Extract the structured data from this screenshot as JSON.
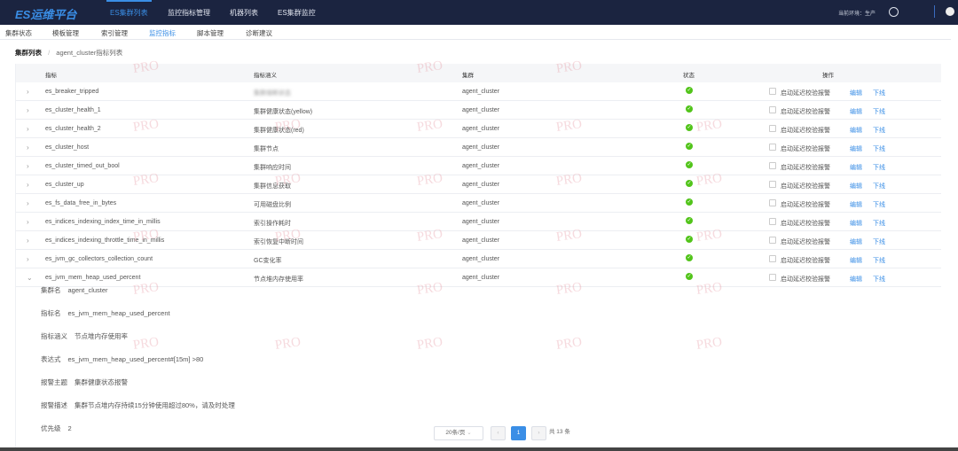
{
  "header": {
    "logo": "ES运维平台",
    "nav": [
      "ES集群列表",
      "监控指标管理",
      "机器列表",
      "ES集群监控"
    ],
    "active_nav": 0,
    "env_label": "当前环境：生产"
  },
  "subnav": {
    "tabs": [
      "集群状态",
      "模板管理",
      "索引管理",
      "监控指标",
      "脚本管理",
      "诊断建议"
    ],
    "active": 3
  },
  "breadcrumb": {
    "root": "集群列表",
    "sep": "/",
    "current": "agent_cluster指标列表"
  },
  "table": {
    "columns": [
      "指标",
      "指标涵义",
      "集群",
      "状态",
      "操作"
    ],
    "op_checkbox_label": "启动延迟校验报警",
    "edit": "编辑",
    "offline": "下线",
    "rows": [
      {
        "metric": "es_breaker_tripped",
        "meaning": "集群熔断状态",
        "cluster": "agent_cluster",
        "blurred": true
      },
      {
        "metric": "es_cluster_health_1",
        "meaning": "集群健康状态(yellow)",
        "cluster": "agent_cluster"
      },
      {
        "metric": "es_cluster_health_2",
        "meaning": "集群健康状态(red)",
        "cluster": "agent_cluster"
      },
      {
        "metric": "es_cluster_host",
        "meaning": "集群节点",
        "cluster": "agent_cluster"
      },
      {
        "metric": "es_cluster_timed_out_bool",
        "meaning": "集群响应时间",
        "cluster": "agent_cluster"
      },
      {
        "metric": "es_cluster_up",
        "meaning": "集群信息获取",
        "cluster": "agent_cluster"
      },
      {
        "metric": "es_fs_data_free_in_bytes",
        "meaning": "可用磁盘比例",
        "cluster": "agent_cluster"
      },
      {
        "metric": "es_indices_indexing_index_time_in_millis",
        "meaning": "索引操作耗时",
        "cluster": "agent_cluster"
      },
      {
        "metric": "es_indices_indexing_throttle_time_in_millis",
        "meaning": "索引恢复中断时间",
        "cluster": "agent_cluster"
      },
      {
        "metric": "es_jvm_gc_collectors_collection_count",
        "meaning": "GC变化率",
        "cluster": "agent_cluster"
      },
      {
        "metric": "es_jvm_mem_heap_used_percent",
        "meaning": "节点堆内存使用率",
        "cluster": "agent_cluster",
        "expanded": true
      }
    ]
  },
  "detail": [
    {
      "k": "集群名",
      "v": "agent_cluster"
    },
    {
      "k": "指标名",
      "v": "es_jvm_mem_heap_used_percent"
    },
    {
      "k": "指标涵义",
      "v": "节点堆内存使用率"
    },
    {
      "k": "表达式",
      "v": "es_jvm_mem_heap_used_percent#[15m] >80"
    },
    {
      "k": "报警主题",
      "v": "集群健康状态报警"
    },
    {
      "k": "报警描述",
      "v": "集群节点堆内存持续15分钟使用超过80%，请及时处理"
    },
    {
      "k": "优先级",
      "v": "2"
    }
  ],
  "pagination": {
    "page_size": "20条/页",
    "current": "1",
    "total": "共 13 条"
  },
  "watermark": "PRO",
  "colors": {
    "nav_bg": "#1b2440",
    "accent": "#3a8ee6",
    "ok": "#52c41a"
  }
}
